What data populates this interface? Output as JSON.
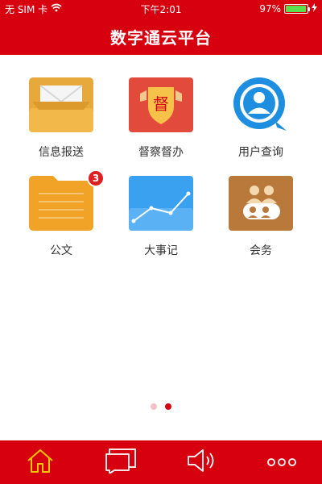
{
  "status_bar": {
    "carrier": "无 SIM 卡",
    "time": "下午2:01",
    "battery_percent": "97%",
    "battery_level": 0.97
  },
  "header": {
    "title": "数字通云平台"
  },
  "apps": [
    {
      "label": "信息报送",
      "icon": "mailbox-icon"
    },
    {
      "label": "督察督办",
      "icon": "supervision-shield-icon",
      "glyph": "督"
    },
    {
      "label": "用户查询",
      "icon": "user-search-icon"
    },
    {
      "label": "公文",
      "icon": "document-folder-icon",
      "badge": "3"
    },
    {
      "label": "大事记",
      "icon": "line-chart-icon"
    },
    {
      "label": "会务",
      "icon": "meeting-icon"
    }
  ],
  "pager": {
    "total": 2,
    "active_index": 1
  },
  "tab_bar": {
    "tabs": [
      {
        "icon": "home-icon"
      },
      {
        "icon": "message-icon"
      },
      {
        "icon": "speaker-icon"
      },
      {
        "icon": "more-icon"
      }
    ]
  },
  "colors": {
    "brand": "#d7000f",
    "tab_active": "#f7c600",
    "tab_inactive": "#ffffff",
    "label_text": "#333333"
  }
}
